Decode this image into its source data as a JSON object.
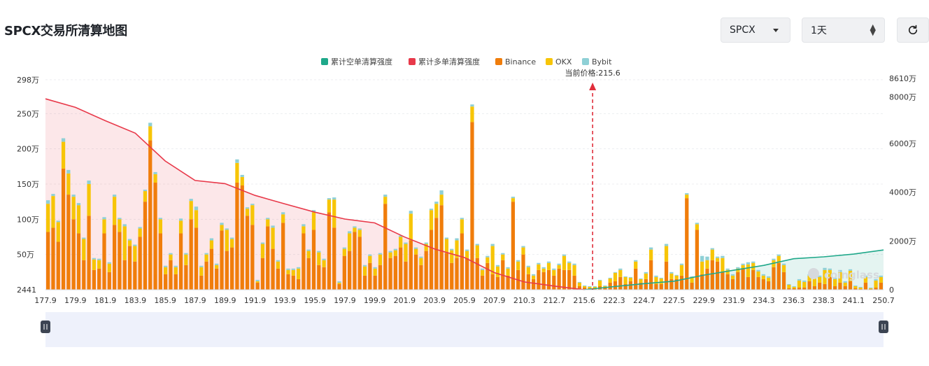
{
  "header": {
    "title": "SPCX交易所清算地图",
    "symbol_value": "SPCX",
    "timeframe_value": "1天",
    "refresh_icon": "refresh-icon"
  },
  "watermark": "coinglass",
  "chart_data": {
    "type": "bar",
    "title": "",
    "current_price_label": "当前价格:215.6",
    "current_price": 215.6,
    "legend": [
      {
        "name": "累计空单清算强度",
        "color": "#1fa88a"
      },
      {
        "name": "累计多单清算强度",
        "color": "#e8394a"
      },
      {
        "name": "Binance",
        "color": "#f07d0b"
      },
      {
        "name": "OKX",
        "color": "#f7c507"
      },
      {
        "name": "Bybit",
        "color": "#8fd0d6"
      }
    ],
    "x_ticks": [
      "177.9",
      "179.9",
      "181.9",
      "183.9",
      "185.9",
      "187.9",
      "189.9",
      "191.9",
      "193.9",
      "195.9",
      "197.9",
      "199.9",
      "201.9",
      "203.9",
      "205.9",
      "207.9",
      "210.3",
      "212.7",
      "215.6",
      "222.3",
      "224.7",
      "227.5",
      "229.9",
      "231.9",
      "234.3",
      "236.3",
      "238.3",
      "241.1",
      "250.7"
    ],
    "y_left_ticks": [
      "2441",
      "50万",
      "100万",
      "150万",
      "200万",
      "250万",
      "298万"
    ],
    "y_right_ticks": [
      "0",
      "2000万",
      "4000万",
      "6000万",
      "8000万",
      "8610万"
    ],
    "y_left_range": [
      0,
      298
    ],
    "y_right_range": [
      0,
      8610
    ],
    "y_left_unit": "万",
    "y_right_unit": "万",
    "grid": true,
    "legend_position": "top-center",
    "series": [
      {
        "name": "Binance",
        "values": [
          82,
          88,
          68,
          172,
          135,
          100,
          80,
          42,
          105,
          28,
          30,
          80,
          25,
          92,
          82,
          42,
          62,
          40,
          75,
          125,
          212,
          152,
          80,
          22,
          42,
          22,
          80,
          35,
          100,
          88,
          20,
          40,
          58,
          30,
          84,
          55,
          60,
          152,
          148,
          105,
          92,
          10,
          45,
          90,
          58,
          30,
          95,
          22,
          20,
          15,
          80,
          45,
          85,
          35,
          32,
          110,
          88,
          8,
          48,
          55,
          82,
          75,
          20,
          38,
          20,
          35,
          122,
          45,
          48,
          60,
          40,
          70,
          50,
          35,
          55,
          85,
          102,
          120,
          52,
          38,
          45,
          80,
          45,
          238,
          45,
          20,
          38,
          22,
          18,
          42,
          20,
          125,
          28,
          50,
          22,
          15,
          28,
          25,
          28,
          20,
          30,
          28,
          28,
          20,
          5,
          3,
          2,
          2,
          5,
          3,
          10,
          12,
          18,
          8,
          12,
          30,
          10,
          15,
          42,
          8,
          8,
          40,
          15,
          15,
          20,
          130,
          10,
          85,
          22,
          30,
          42,
          40,
          25,
          22,
          15,
          25,
          30,
          18,
          28,
          18,
          15,
          12,
          32,
          38,
          25,
          2,
          2,
          3,
          3,
          12,
          5,
          10,
          8,
          18,
          5,
          10,
          5,
          12,
          2,
          1,
          10,
          1,
          3,
          10
        ]
      },
      {
        "name": "OKX",
        "values": [
          40,
          45,
          28,
          38,
          30,
          32,
          40,
          30,
          45,
          15,
          12,
          20,
          12,
          40,
          18,
          48,
          8,
          22,
          12,
          15,
          20,
          12,
          20,
          10,
          8,
          10,
          18,
          15,
          26,
          25,
          12,
          10,
          12,
          5,
          8,
          30,
          12,
          28,
          12,
          10,
          28,
          2,
          20,
          10,
          30,
          10,
          12,
          6,
          8,
          15,
          10,
          10,
          25,
          18,
          10,
          18,
          40,
          2,
          10,
          25,
          6,
          10,
          13,
          10,
          10,
          15,
          10,
          8,
          8,
          15,
          25,
          38,
          8,
          10,
          10,
          28,
          20,
          15,
          20,
          18,
          25,
          20,
          10,
          22,
          18,
          8,
          8,
          40,
          15,
          8,
          10,
          5,
          12,
          10,
          10,
          5,
          8,
          5,
          10,
          8,
          5,
          20,
          10,
          15,
          5,
          2,
          2,
          2,
          8,
          2,
          6,
          12,
          10,
          10,
          5,
          10,
          5,
          8,
          15,
          10,
          8,
          22,
          8,
          5,
          15,
          5,
          8,
          8,
          18,
          12,
          15,
          5,
          20,
          6,
          5,
          5,
          5,
          18,
          10,
          8,
          5,
          5,
          10,
          10,
          10,
          5,
          2,
          10,
          8,
          8,
          20,
          8,
          20,
          10,
          10,
          15,
          5,
          15,
          3,
          2,
          8,
          1,
          10,
          8
        ]
      },
      {
        "name": "Bybit",
        "values": [
          5,
          3,
          2,
          5,
          5,
          3,
          3,
          2,
          5,
          2,
          2,
          3,
          2,
          3,
          2,
          3,
          2,
          2,
          2,
          2,
          5,
          3,
          2,
          2,
          2,
          2,
          3,
          2,
          3,
          5,
          2,
          2,
          3,
          2,
          3,
          2,
          2,
          5,
          3,
          2,
          2,
          2,
          2,
          2,
          3,
          2,
          3,
          2,
          2,
          2,
          3,
          2,
          3,
          2,
          2,
          2,
          3,
          2,
          2,
          3,
          2,
          2,
          2,
          2,
          2,
          2,
          3,
          2,
          2,
          2,
          2,
          4,
          2,
          2,
          2,
          2,
          3,
          6,
          2,
          2,
          3,
          2,
          2,
          3,
          2,
          2,
          2,
          3,
          2,
          2,
          2,
          2,
          2,
          2,
          2,
          2,
          2,
          2,
          2,
          2,
          2,
          2,
          2,
          2,
          1,
          1,
          1,
          1,
          1,
          1,
          1,
          1,
          2,
          1,
          1,
          2,
          1,
          2,
          3,
          2,
          1,
          3,
          2,
          1,
          2,
          2,
          1,
          2,
          8,
          5,
          2,
          2,
          3,
          2,
          2,
          2,
          2,
          3,
          2,
          2,
          2,
          2,
          2,
          2,
          2,
          1,
          1,
          2,
          2,
          2,
          3,
          2,
          3,
          2,
          2,
          3,
          2,
          2,
          1,
          1,
          2,
          1,
          2,
          2
        ]
      },
      {
        "name": "累计多单清算强度",
        "points": [
          [
            177.9,
            7830
          ],
          [
            179.9,
            7480
          ],
          [
            181.9,
            6930
          ],
          [
            183.9,
            6420
          ],
          [
            185.9,
            5280
          ],
          [
            187.9,
            4480
          ],
          [
            189.9,
            4350
          ],
          [
            191.9,
            3870
          ],
          [
            193.9,
            3520
          ],
          [
            195.9,
            3180
          ],
          [
            197.9,
            2900
          ],
          [
            199.9,
            2740
          ],
          [
            201.9,
            2160
          ],
          [
            203.9,
            1670
          ],
          [
            205.9,
            1320
          ],
          [
            207.9,
            700
          ],
          [
            210.3,
            320
          ],
          [
            212.7,
            150
          ],
          [
            215.6,
            0
          ]
        ]
      },
      {
        "name": "累计空单清算强度",
        "points": [
          [
            215.6,
            0
          ],
          [
            222.3,
            130
          ],
          [
            224.7,
            250
          ],
          [
            227.5,
            350
          ],
          [
            229.9,
            600
          ],
          [
            231.9,
            800
          ],
          [
            234.3,
            1000
          ],
          [
            236.3,
            1270
          ],
          [
            238.3,
            1350
          ],
          [
            241.1,
            1460
          ],
          [
            250.7,
            1630
          ]
        ]
      }
    ]
  }
}
